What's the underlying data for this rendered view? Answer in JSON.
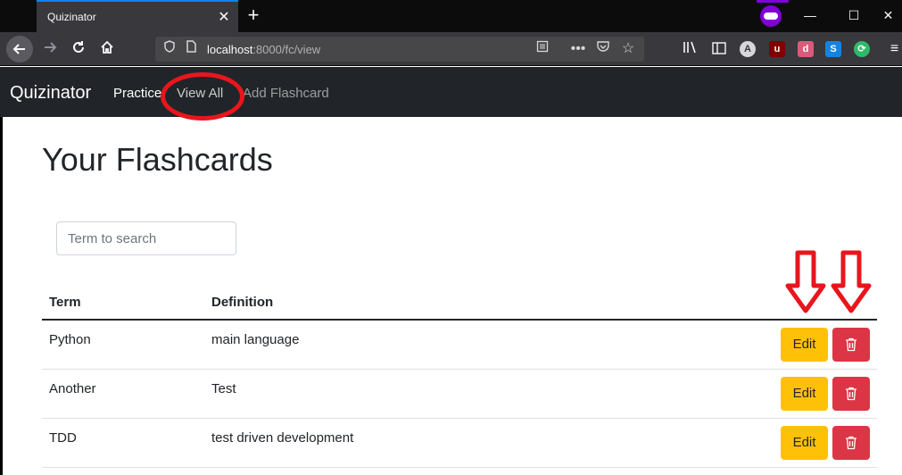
{
  "browser": {
    "tab_title": "Quizinator",
    "tab_close": "✕",
    "new_tab": "+",
    "url_host": "localhost",
    "url_path": ":8000/fc/view",
    "window_minimize": "—",
    "window_maximize": "☐",
    "window_close": "✕",
    "extensions": [
      {
        "name": "account-icon",
        "glyph": "A",
        "color": "#d7d7db"
      },
      {
        "name": "ublock-icon",
        "glyph": "u",
        "color": "#800000"
      },
      {
        "name": "decentraleyes-icon",
        "glyph": "d",
        "color": "#d95b7b"
      },
      {
        "name": "s-extension-icon",
        "glyph": "S",
        "color": "#1683e3"
      },
      {
        "name": "sync-icon",
        "glyph": "⟳",
        "color": "#2fb96a"
      }
    ]
  },
  "app": {
    "brand": "Quizinator",
    "nav": {
      "practice": "Practice",
      "view_all": "View All",
      "add_flashcard": "Add Flashcard"
    },
    "page_title": "Your Flashcards",
    "search": {
      "placeholder": "Term to search",
      "value": ""
    },
    "table": {
      "headers": {
        "term": "Term",
        "definition": "Definition"
      },
      "edit_label": "Edit",
      "rows": [
        {
          "term": "Python",
          "definition": "main language"
        },
        {
          "term": "Another",
          "definition": "Test"
        },
        {
          "term": "TDD",
          "definition": "test driven development"
        }
      ]
    }
  },
  "colors": {
    "annotation_red": "#e8161c",
    "navbar_bg": "#212529",
    "edit_yellow": "#ffc107",
    "delete_red": "#dc3545",
    "browser_accent": "#0a84ff",
    "private_purple": "#8000d7"
  }
}
